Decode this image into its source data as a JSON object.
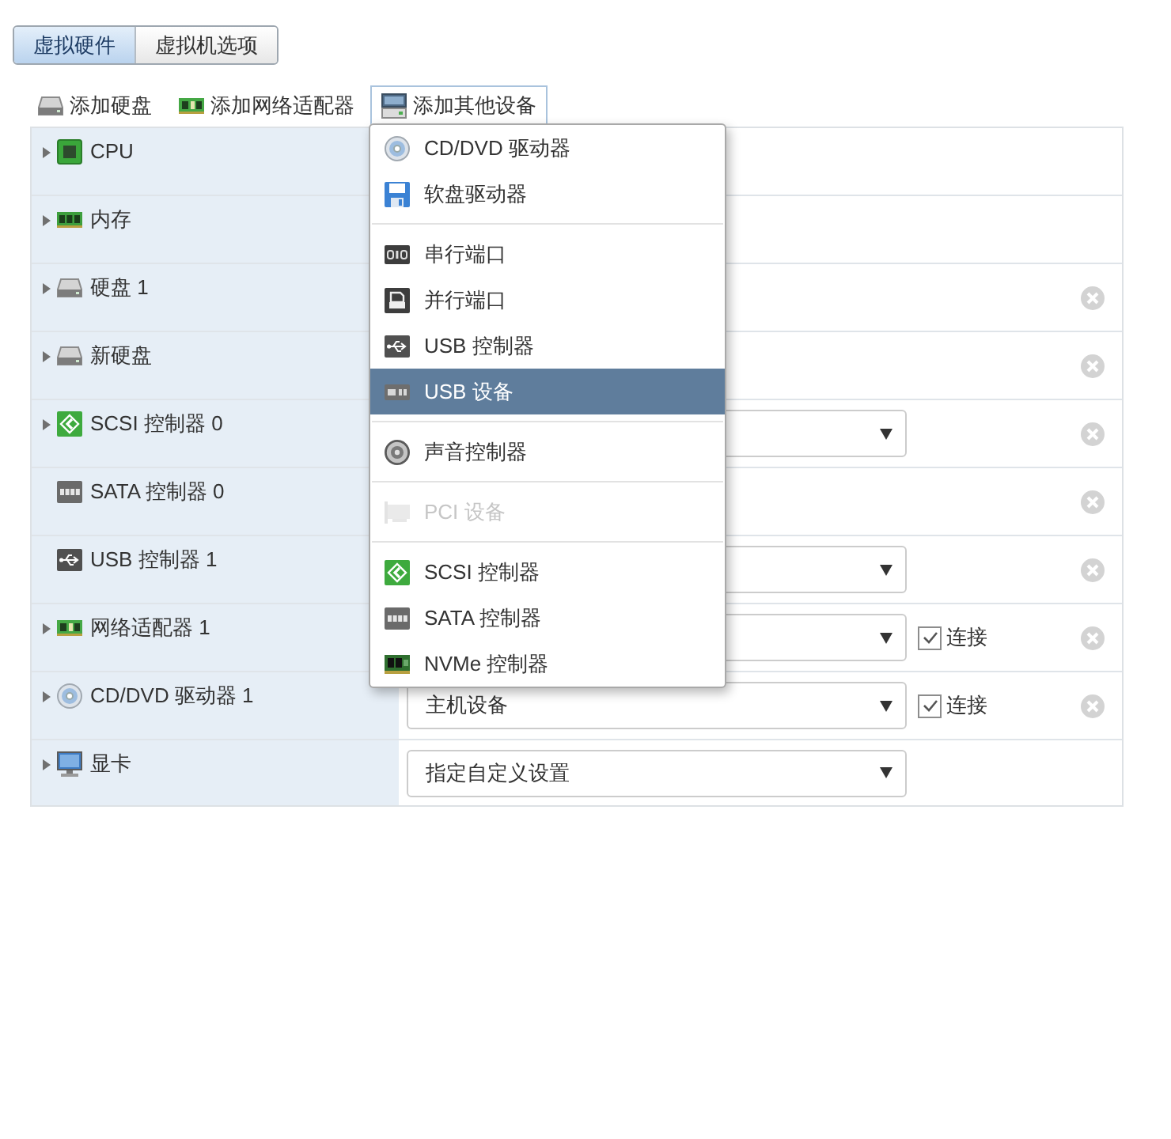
{
  "tabs": [
    {
      "label": "虚拟硬件",
      "selected": true
    },
    {
      "label": "虚拟机选项",
      "selected": false
    }
  ],
  "toolbar": [
    {
      "label": "添加硬盘",
      "open": false
    },
    {
      "label": "添加网络适配器",
      "open": false
    },
    {
      "label": "添加其他设备",
      "open": true
    }
  ],
  "devices": [
    {
      "name": "CPU",
      "kind": "plain",
      "expandable": true,
      "removable": false
    },
    {
      "name": "内存",
      "kind": "plain",
      "expandable": true,
      "removable": false
    },
    {
      "name": "硬盘 1",
      "kind": "plain",
      "expandable": true,
      "removable": true
    },
    {
      "name": "新硬盘",
      "kind": "plain",
      "expandable": true,
      "removable": true
    },
    {
      "name": "SCSI 控制器 0",
      "kind": "select",
      "expandable": true,
      "removable": true
    },
    {
      "name": "SATA 控制器 0",
      "kind": "plain",
      "expandable": false,
      "removable": true
    },
    {
      "name": "USB 控制器 1",
      "kind": "select",
      "expandable": false,
      "removable": true
    },
    {
      "name": "网络适配器 1",
      "kind": "select",
      "expandable": true,
      "removable": true,
      "connect": {
        "label": "连接",
        "checked": true
      }
    },
    {
      "name": "CD/DVD 驱动器 1",
      "kind": "select",
      "value": "主机设备",
      "expandable": true,
      "removable": true,
      "connect": {
        "label": "连接",
        "checked": true
      }
    },
    {
      "name": "显卡",
      "kind": "select",
      "value": "指定自定义设置",
      "expandable": true,
      "removable": false
    }
  ],
  "menu": {
    "groups": [
      {
        "items": [
          {
            "label": "CD/DVD 驱动器",
            "selected": false,
            "disabled": false
          },
          {
            "label": "软盘驱动器",
            "selected": false,
            "disabled": false
          }
        ]
      },
      {
        "items": [
          {
            "label": "串行端口",
            "selected": false,
            "disabled": false
          },
          {
            "label": "并行端口",
            "selected": false,
            "disabled": false
          },
          {
            "label": "USB 控制器",
            "selected": false,
            "disabled": false
          },
          {
            "label": "USB 设备",
            "selected": true,
            "disabled": false
          }
        ]
      },
      {
        "items": [
          {
            "label": "声音控制器",
            "selected": false,
            "disabled": false
          }
        ]
      },
      {
        "items": [
          {
            "label": "PCI 设备",
            "selected": false,
            "disabled": true
          }
        ]
      },
      {
        "items": [
          {
            "label": "SCSI 控制器",
            "selected": false,
            "disabled": false
          },
          {
            "label": "SATA 控制器",
            "selected": false,
            "disabled": false
          },
          {
            "label": "NVMe 控制器",
            "selected": false,
            "disabled": false
          }
        ]
      }
    ]
  }
}
